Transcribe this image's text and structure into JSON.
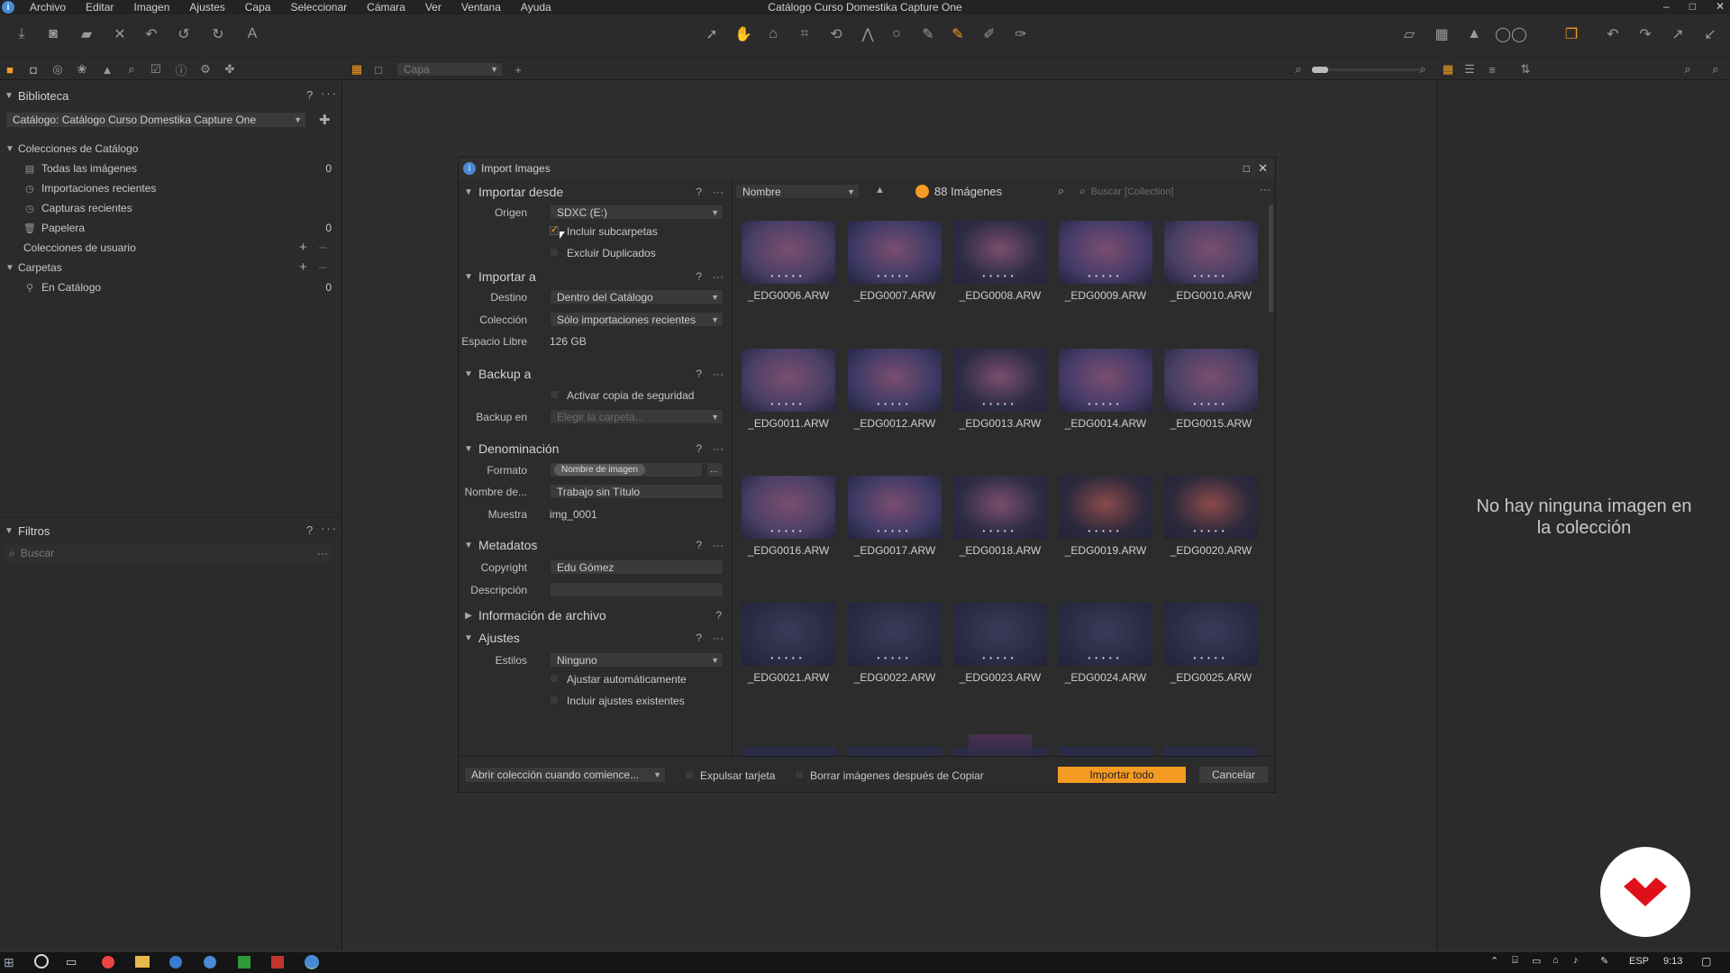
{
  "menubar": {
    "items": [
      "Archivo",
      "Editar",
      "Imagen",
      "Ajustes",
      "Capa",
      "Seleccionar",
      "Cámara",
      "Ver",
      "Ventana",
      "Ayuda"
    ],
    "title": "Catálogo Curso Domestika Capture One"
  },
  "subbar": {
    "layer_select": "Capa"
  },
  "library": {
    "title": "Biblioteca",
    "catalog_select": "Catálogo: Catálogo Curso Domestika Capture One",
    "catalog_collections": "Colecciones de Catálogo",
    "items": [
      {
        "label": "Todas las imágenes",
        "count": "0"
      },
      {
        "label": "Importaciones recientes",
        "count": ""
      },
      {
        "label": "Capturas recientes",
        "count": ""
      },
      {
        "label": "Papelera",
        "count": "0"
      }
    ],
    "user_collections": "Colecciones de usuario",
    "folders": "Carpetas",
    "in_catalog": {
      "label": "En Catálogo",
      "count": "0"
    }
  },
  "filters": {
    "title": "Filtros",
    "search_placeholder": "Buscar"
  },
  "right_panel": {
    "message": "No hay ninguna imagen en la colección"
  },
  "dialog": {
    "title": "Import Images",
    "import_from": {
      "header": "Importar desde",
      "origin_label": "Origen",
      "origin_value": "SDXC (E:)",
      "include_subfolders": "Incluir subcarpetas",
      "exclude_duplicates": "Excluir Duplicados"
    },
    "import_to": {
      "header": "Importar a",
      "dest_label": "Destino",
      "dest_value": "Dentro del Catálogo",
      "collection_label": "Colección",
      "collection_value": "Sólo importaciones recientes",
      "free_label": "Espacio Libre",
      "free_value": "126 GB"
    },
    "backup": {
      "header": "Backup a",
      "activate": "Activar copia de seguridad",
      "backup_label": "Backup en",
      "backup_value": "Elegir la carpeta..."
    },
    "naming": {
      "header": "Denominación",
      "format_label": "Formato",
      "format_token": "Nombre de imagen",
      "name_label": "Nombre de...",
      "name_value": "Trabajo sin Título",
      "sample_label": "Muestra",
      "sample_value": "img_0001"
    },
    "metadata": {
      "header": "Metadatos",
      "copyright_label": "Copyright",
      "copyright_value": "Edu Gómez",
      "description_label": "Descripción",
      "description_value": ""
    },
    "file_info": {
      "header": "Información de archivo"
    },
    "adjustments": {
      "header": "Ajustes",
      "styles_label": "Estilos",
      "styles_value": "Ninguno",
      "auto_adjust": "Ajustar automáticamente",
      "include_existing": "Incluir ajustes existentes"
    },
    "grid": {
      "sort_value": "Nombre",
      "count": "88 Imágenes",
      "search_placeholder": "Buscar [Collection]",
      "files": [
        "_EDG0006.ARW",
        "_EDG0007.ARW",
        "_EDG0008.ARW",
        "_EDG0009.ARW",
        "_EDG0010.ARW",
        "_EDG0011.ARW",
        "_EDG0012.ARW",
        "_EDG0013.ARW",
        "_EDG0014.ARW",
        "_EDG0015.ARW",
        "_EDG0016.ARW",
        "_EDG0017.ARW",
        "_EDG0018.ARW",
        "_EDG0019.ARW",
        "_EDG0020.ARW",
        "_EDG0021.ARW",
        "_EDG0022.ARW",
        "_EDG0023.ARW",
        "_EDG0024.ARW",
        "_EDG0025.ARW"
      ]
    },
    "bottom": {
      "open_collection": "Abrir colección cuando comience...",
      "eject_card": "Expulsar tarjeta",
      "delete_after": "Borrar imágenes después de Copiar",
      "import_all": "Importar todo",
      "cancel": "Cancelar"
    }
  },
  "taskbar": {
    "lang": "ESP",
    "time": "9:13"
  },
  "colors": {
    "accent": "#f59a23",
    "brand_red": "#e0101a"
  }
}
